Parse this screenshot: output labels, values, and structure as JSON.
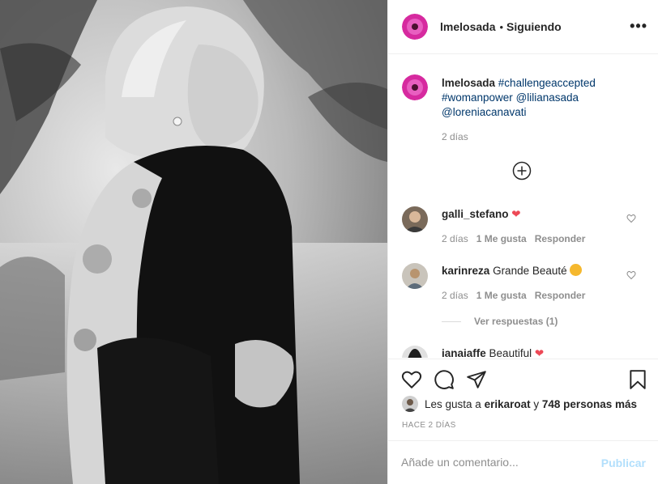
{
  "post": {
    "username": "lmelosada",
    "separator": "•",
    "following_label": "Siguiendo",
    "more_label": "•••"
  },
  "caption": {
    "username": "lmelosada",
    "tag1": "#challengeaccepted",
    "tag2": "#womanpower",
    "mention1": "@lilianasada",
    "mention2": "@loreniacanavati",
    "time": "2 días"
  },
  "comments": [
    {
      "username": "galli_stefano",
      "text": "",
      "emoji": "heart",
      "time": "2 días",
      "likes": "1 Me gusta",
      "reply": "Responder"
    },
    {
      "username": "karinreza",
      "text": "Grande Beauté",
      "emoji": "kiss-face",
      "time": "2 días",
      "likes": "1 Me gusta",
      "reply": "Responder"
    },
    {
      "username": "ianaiaffe",
      "text": "Beautiful",
      "emoji": "heart"
    }
  ],
  "view_replies": "Ver respuestas (1)",
  "likes": {
    "prefix": "Les gusta a",
    "user": "erikaroat",
    "joiner": "y",
    "others": "748 personas más"
  },
  "time_ago": "HACE 2 DÍAS",
  "add_comment": {
    "placeholder": "Añade un comentario...",
    "publish_label": "Publicar"
  },
  "colors": {
    "link": "#00376b",
    "muted": "#8e8e8e",
    "publish_disabled": "#b2dffc",
    "heart_red": "#ed4956",
    "avatar_pink": "#d62a9f"
  },
  "icons": [
    "more-options-icon",
    "add-circle-icon",
    "heart-icon",
    "comment-icon",
    "share-icon",
    "bookmark-icon"
  ]
}
